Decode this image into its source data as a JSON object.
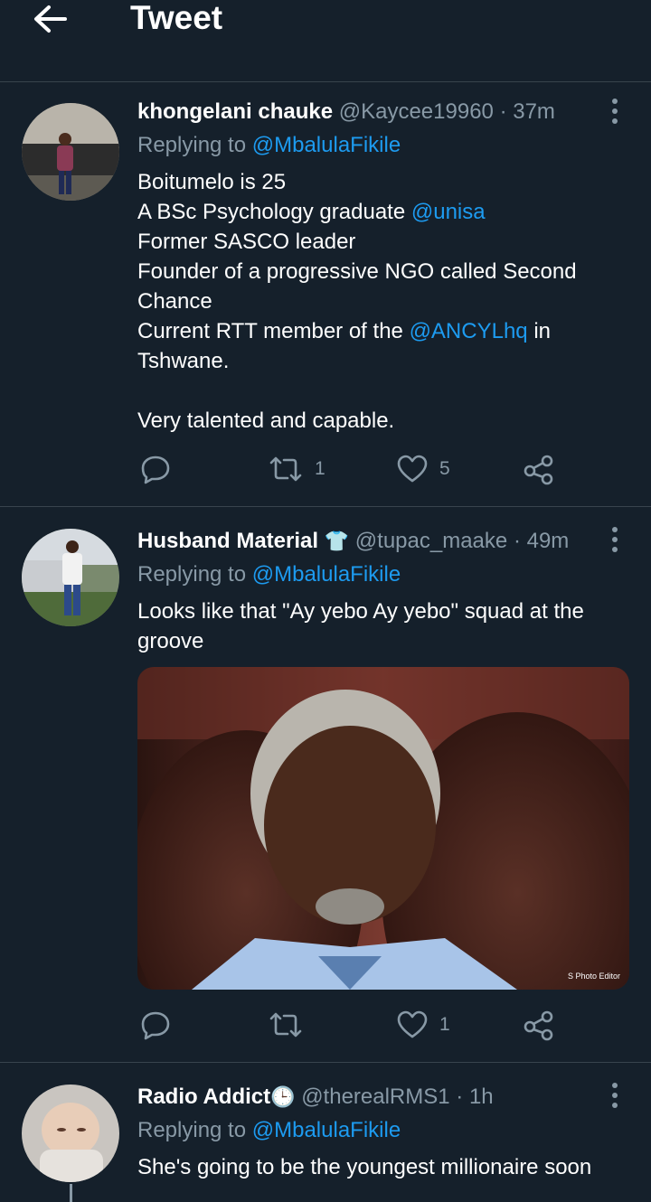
{
  "header": {
    "title": "Tweet"
  },
  "tweets": [
    {
      "name": "khongelani chauke",
      "handle": "@Kaycee19960",
      "time": "· 37m",
      "replying_label": "Replying to",
      "replying_to": "@MbalulaFikile",
      "lines": [
        "Boitumelo is 25",
        [
          "A BSc Psychology graduate ",
          "@unisa"
        ],
        "Former SASCO leader",
        "Founder of a progressive NGO called Second",
        "Chance",
        [
          "Current RTT member of the ",
          "@ANCYLhq",
          " in"
        ],
        "Tshwane.",
        "",
        "Very talented and capable."
      ],
      "body": {
        "l1": "Boitumelo is 25",
        "l2a": "A BSc Psychology graduate ",
        "l2m": "@unisa",
        "l3": "Former SASCO leader",
        "l4": "Founder of a progressive NGO called Second",
        "l5": "Chance",
        "l6a": "Current RTT member of the ",
        "l6m": "@ANCYLhq",
        "l6b": " in",
        "l7": "Tshwane.",
        "l9": "Very talented and capable."
      },
      "retweets": "1",
      "likes": "5"
    },
    {
      "name": "Husband Material",
      "emoji": "👕",
      "handle": "@tupac_maake",
      "time": "· 49m",
      "replying_label": "Replying to",
      "replying_to": "@MbalulaFikile",
      "body": {
        "l1": "Looks like that \"Ay yebo Ay yebo\" squad at the",
        "l2": "groove"
      },
      "image_watermark": "S Photo Editor",
      "retweets": "",
      "likes": "1"
    },
    {
      "name": "Radio Addict",
      "emoji": "🕒",
      "handle": "@therealRMS1",
      "time": "· 1h",
      "replying_label": "Replying to",
      "replying_to": "@MbalulaFikile",
      "body": {
        "l1": "She's going to be the youngest millionaire soon"
      }
    }
  ],
  "colors": {
    "background": "#15202b",
    "accent": "#1d9bf0",
    "secondary_text": "#8899a6",
    "divider": "#38444d"
  },
  "icons": [
    "back-arrow-icon",
    "more-vertical-icon",
    "reply-icon",
    "retweet-icon",
    "like-icon",
    "share-icon"
  ]
}
